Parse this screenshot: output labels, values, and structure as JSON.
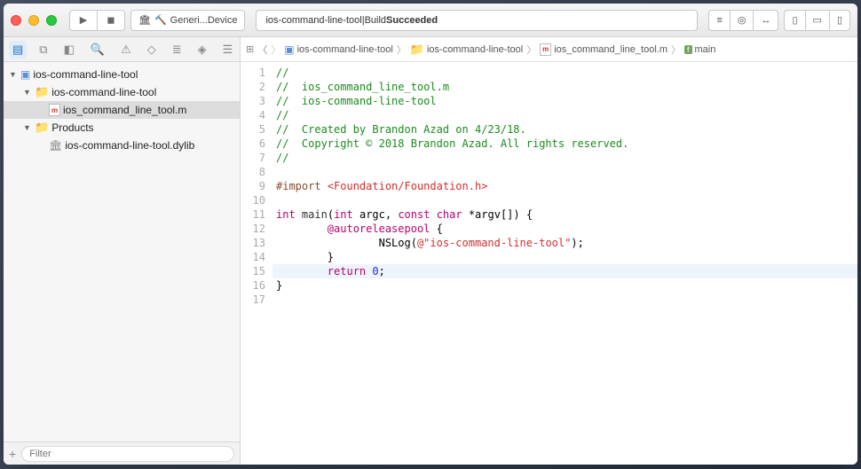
{
  "titlebar": {
    "scheme_target": "Generi...Device",
    "status_project": "ios-command-line-tool",
    "status_sep": " | ",
    "status_action": "Build ",
    "status_result": "Succeeded"
  },
  "navigator": {
    "tree": [
      {
        "indent": 0,
        "kind": "project",
        "label": "ios-command-line-tool",
        "open": true
      },
      {
        "indent": 1,
        "kind": "folder",
        "label": "ios-command-line-tool",
        "open": true
      },
      {
        "indent": 2,
        "kind": "mfile",
        "label": "ios_command_line_tool.m",
        "sel": true
      },
      {
        "indent": 1,
        "kind": "folder",
        "label": "Products",
        "open": true
      },
      {
        "indent": 2,
        "kind": "dylib",
        "label": "ios-command-line-tool.dylib"
      }
    ],
    "filter_placeholder": "Filter"
  },
  "jumpbar": {
    "c1": "ios-command-line-tool",
    "c2": "ios-command-line-tool",
    "c3": "ios_command_line_tool.m",
    "c4": "main"
  },
  "code": {
    "lines": [
      {
        "n": 1,
        "html": "<span class='c-comment'>//</span>"
      },
      {
        "n": 2,
        "html": "<span class='c-comment'>//  ios_command_line_tool.m</span>"
      },
      {
        "n": 3,
        "html": "<span class='c-comment'>//  ios-command-line-tool</span>"
      },
      {
        "n": 4,
        "html": "<span class='c-comment'>//</span>"
      },
      {
        "n": 5,
        "html": "<span class='c-comment'>//  Created by Brandon Azad on 4/23/18.</span>"
      },
      {
        "n": 6,
        "html": "<span class='c-comment'>//  Copyright © 2018 Brandon Azad. All rights reserved.</span>"
      },
      {
        "n": 7,
        "html": "<span class='c-comment'>//</span>"
      },
      {
        "n": 8,
        "html": ""
      },
      {
        "n": 9,
        "html": "<span class='c-import'>#import</span> <span class='c-import-path'>&lt;Foundation/Foundation.h&gt;</span>"
      },
      {
        "n": 10,
        "html": ""
      },
      {
        "n": 11,
        "html": "<span class='c-type'>int</span> <span class='c-func'>main</span>(<span class='c-type'>int</span> argc, <span class='c-type'>const</span> <span class='c-type'>char</span> *argv[]) {"
      },
      {
        "n": 12,
        "html": "        <span class='c-keyword'>@autoreleasepool</span> {"
      },
      {
        "n": 13,
        "html": "                NSLog(<span class='c-string'>@\"ios-command-line-tool\"</span>);"
      },
      {
        "n": 14,
        "html": "        }"
      },
      {
        "n": 15,
        "hl": true,
        "html": "        <span class='c-keyword'>return</span> <span class='c-number'>0</span>;"
      },
      {
        "n": 16,
        "html": "}"
      },
      {
        "n": 17,
        "html": ""
      }
    ]
  }
}
